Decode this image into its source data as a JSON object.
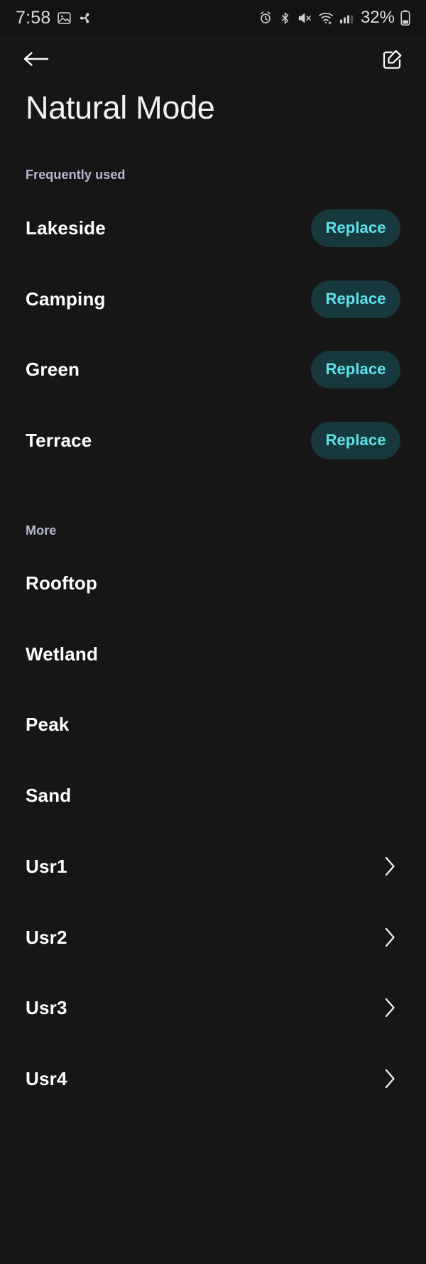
{
  "status_bar": {
    "time": "7:58",
    "battery_percent": "32%",
    "left_icons": [
      "screenshot-icon",
      "fan-icon"
    ],
    "right_icons": [
      "alarm-icon",
      "bluetooth-icon",
      "mute-icon",
      "wifi-icon",
      "signal-icon",
      "battery-icon"
    ]
  },
  "app_bar": {
    "back_icon": "arrow-left-icon",
    "edit_icon": "edit-compose-icon"
  },
  "title": "Natural Mode",
  "sections": [
    {
      "header": "Frequently used",
      "items": [
        {
          "label": "Lakeside",
          "action": "Replace"
        },
        {
          "label": "Camping",
          "action": "Replace"
        },
        {
          "label": "Green",
          "action": "Replace"
        },
        {
          "label": "Terrace",
          "action": "Replace"
        }
      ]
    },
    {
      "header": "More",
      "items": [
        {
          "label": "Rooftop"
        },
        {
          "label": "Wetland"
        },
        {
          "label": "Peak"
        },
        {
          "label": "Sand"
        },
        {
          "label": "Usr1",
          "chevron": true
        },
        {
          "label": "Usr2",
          "chevron": true
        },
        {
          "label": "Usr3",
          "chevron": true
        },
        {
          "label": "Usr4",
          "chevron": true
        }
      ]
    }
  ],
  "colors": {
    "background": "#161616",
    "status_bar_bg": "#131313",
    "section_header": "#b7bbd2",
    "row_label": "#ffffff",
    "button_bg": "#17383c",
    "button_text": "#5fe1ea"
  }
}
